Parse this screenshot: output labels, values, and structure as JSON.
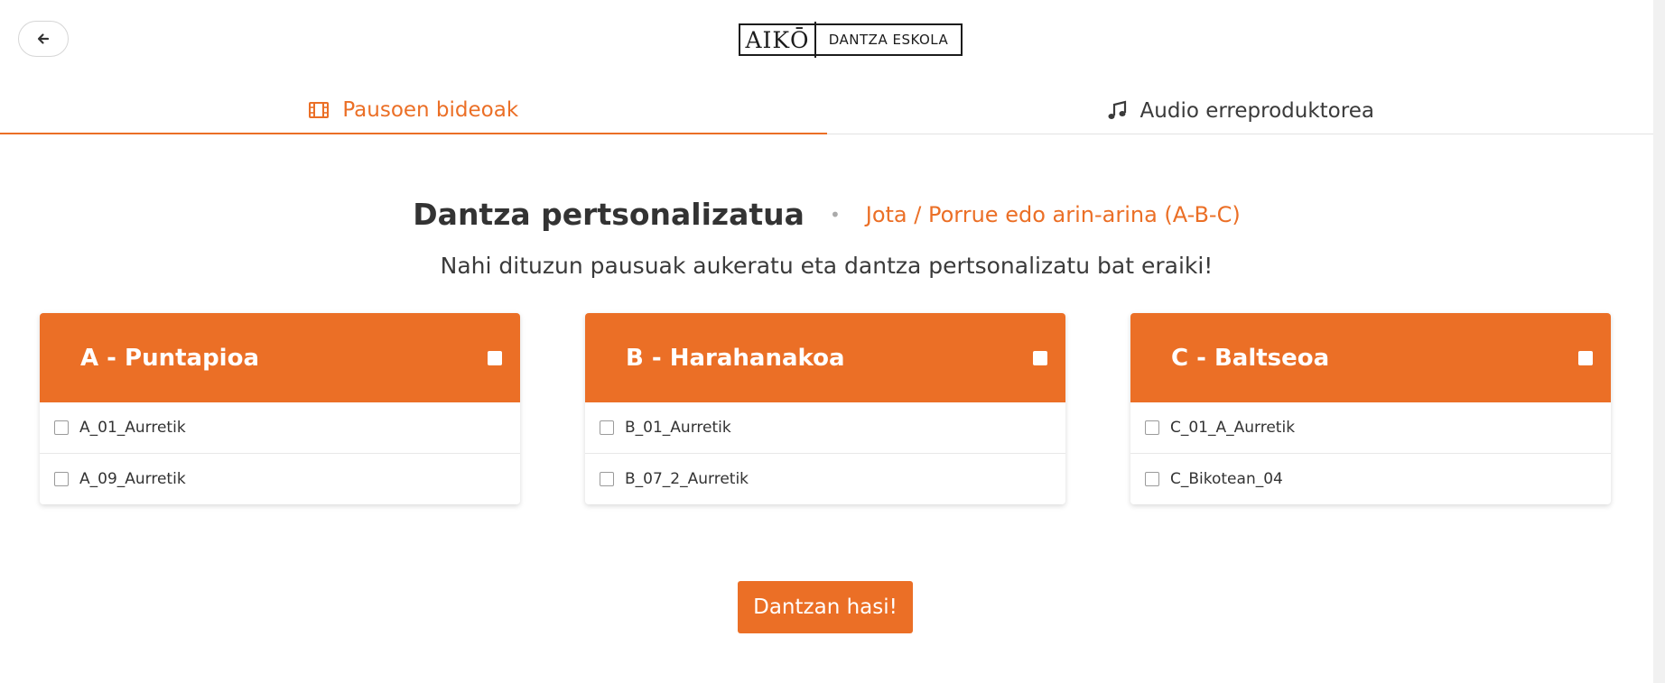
{
  "header": {
    "logo_main": "AIKŌ",
    "logo_sub": "DANTZA ESKOLA"
  },
  "tabs": [
    {
      "label": "Pausoen bideoak",
      "icon": "film-icon",
      "active": true
    },
    {
      "label": "Audio erreproduktorea",
      "icon": "music-note-icon",
      "active": false
    }
  ],
  "title": {
    "main": "Dantza pertsonalizatua",
    "separator": "•",
    "subtitle": "Jota / Porrue edo arin-arina (A-B-C)"
  },
  "intro": "Nahi dituzun pausuak aukeratu eta dantza pertsonalizatu bat eraiki!",
  "cards": [
    {
      "title": "A - Puntapioa",
      "steps": [
        "A_01_Aurretik",
        "A_09_Aurretik"
      ]
    },
    {
      "title": "B - Harahanakoa",
      "steps": [
        "B_01_Aurretik",
        "B_07_2_Aurretik"
      ]
    },
    {
      "title": "C - Baltseoa",
      "steps": [
        "C_01_A_Aurretik",
        "C_Bikotean_04"
      ]
    }
  ],
  "start_button": "Dantzan hasi!",
  "colors": {
    "accent": "#eb6f26",
    "text": "#3a3a3a"
  }
}
